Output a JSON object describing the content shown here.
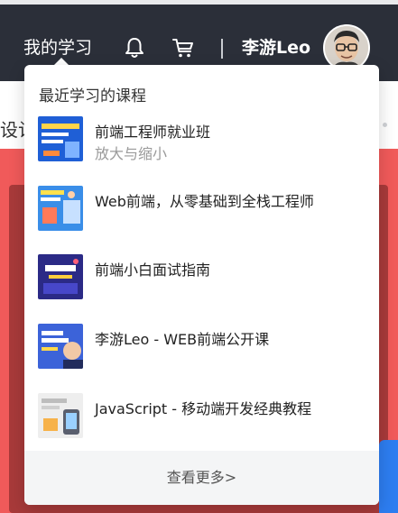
{
  "header": {
    "my_learning": "我的学习",
    "user_name": "李游Leo",
    "separator": "|",
    "bg_color": "#2b2f39"
  },
  "icons": {
    "bell": "bell-icon",
    "cart": "cart-icon",
    "avatar": "user-avatar"
  },
  "background": {
    "partial_text": "设计",
    "banner_color": "#f05a5a"
  },
  "dropdown": {
    "title": "最近学习的课程",
    "courses": [
      {
        "title": "前端工程师就业班",
        "subtitle": "放大与缩小"
      },
      {
        "title": "Web前端，从零基础到全栈工程师",
        "subtitle": ""
      },
      {
        "title": "前端小白面试指南",
        "subtitle": ""
      },
      {
        "title": "李游Leo - WEB前端公开课",
        "subtitle": ""
      },
      {
        "title": "JavaScript - 移动端开发经典教程",
        "subtitle": ""
      }
    ],
    "more_label": "查看更多>"
  }
}
